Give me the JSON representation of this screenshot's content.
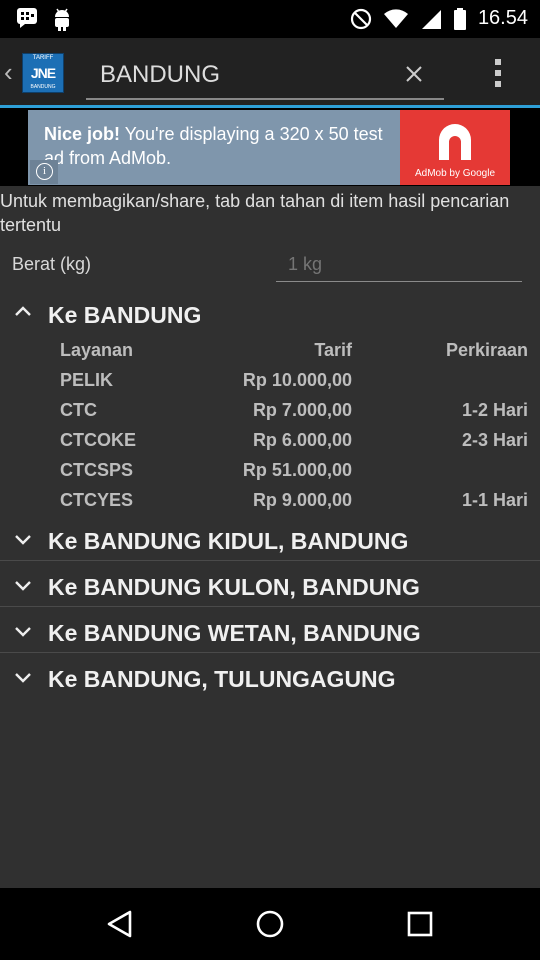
{
  "status_bar": {
    "time": "16.54",
    "icons": [
      "bbm-icon",
      "android-icon",
      "do-not-disturb-icon",
      "wifi-icon",
      "signal-icon",
      "battery-icon"
    ]
  },
  "action_bar": {
    "search_value": "BANDUNG",
    "logo": {
      "top": "TARIFF",
      "brand": "JNE",
      "bottom": "BANDUNG"
    }
  },
  "ad": {
    "headline": "Nice job!",
    "body": " You're displaying a 320 x 50 test ad from AdMob.",
    "brand": "AdMob by Google",
    "brand_color": "#e53935"
  },
  "hint_text": "Untuk membagikan/share, tab dan tahan di item hasil pencarian tertentu",
  "weight": {
    "label": "Berat (kg)",
    "placeholder": "1 kg"
  },
  "expanded_group": {
    "title": "Ke BANDUNG",
    "headers": [
      "Layanan",
      "Tarif",
      "Perkiraan"
    ],
    "rows": [
      {
        "service": "PELIK",
        "tariff": "Rp 10.000,00",
        "estimate": ""
      },
      {
        "service": "CTC",
        "tariff": "Rp 7.000,00",
        "estimate": "1-2 Hari"
      },
      {
        "service": "CTCOKE",
        "tariff": "Rp 6.000,00",
        "estimate": "2-3 Hari"
      },
      {
        "service": "CTCSPS",
        "tariff": "Rp 51.000,00",
        "estimate": ""
      },
      {
        "service": "CTCYES",
        "tariff": "Rp 9.000,00",
        "estimate": "1-1 Hari"
      }
    ]
  },
  "collapsed_groups": [
    {
      "title": "Ke BANDUNG KIDUL, BANDUNG"
    },
    {
      "title": "Ke BANDUNG KULON, BANDUNG"
    },
    {
      "title": "Ke BANDUNG WETAN, BANDUNG"
    },
    {
      "title": "Ke BANDUNG, TULUNGAGUNG"
    }
  ],
  "colors": {
    "accent": "#2ea0d8",
    "background": "#303030",
    "action_bar": "#222222"
  }
}
